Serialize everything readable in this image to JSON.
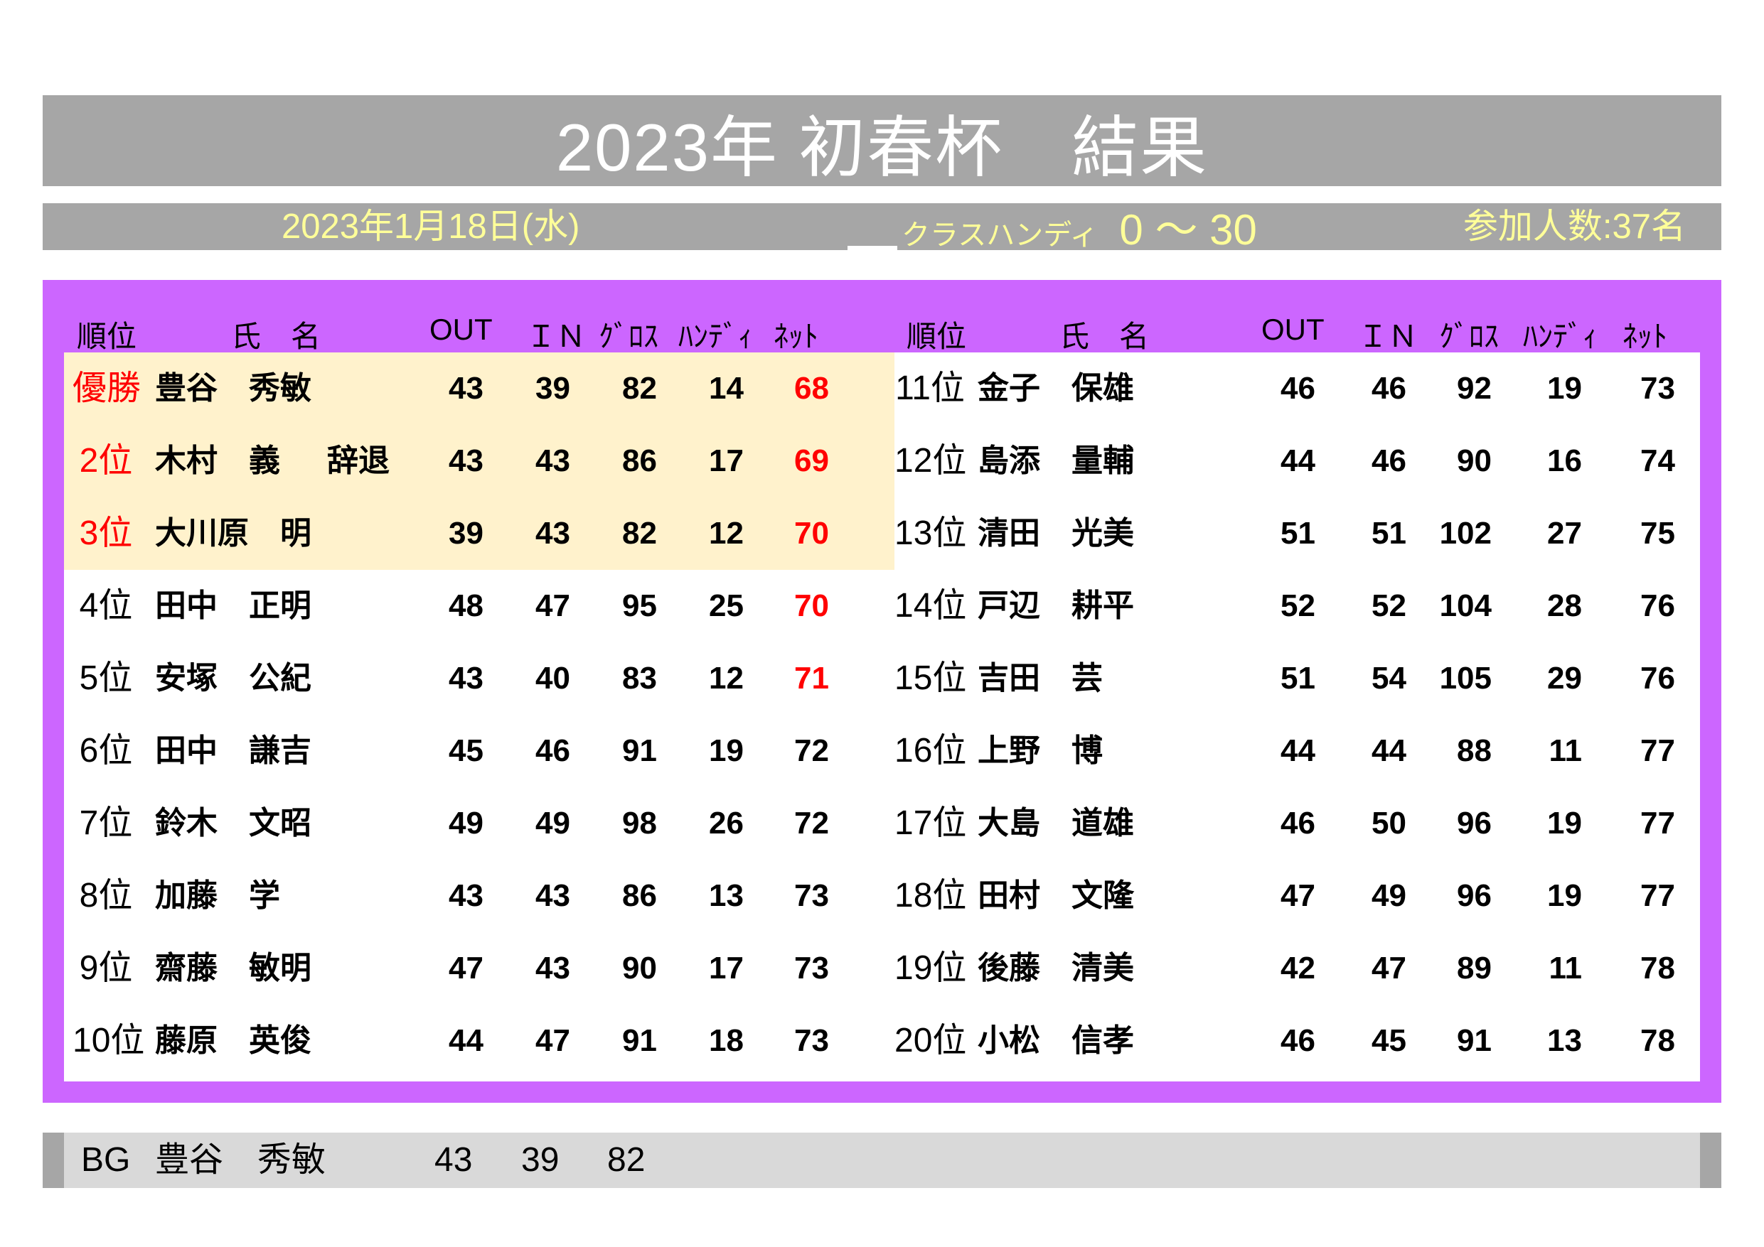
{
  "title": "2023年 初春杯　結果",
  "subtitle": {
    "date": "2023年1月18日(水)",
    "class_label": "クラスハンディ",
    "class_value": "0 ～ 30",
    "participants": "参加人数:37名"
  },
  "headers": {
    "rank": "順位",
    "name": "氏　名",
    "out": "OUT",
    "in": "ＩＮ",
    "gross": "ｸﾞﾛｽ",
    "handicap": "ﾊﾝﾃﾞｨ",
    "net": "ﾈｯﾄ"
  },
  "left_rows": [
    {
      "rank": "優勝",
      "name": "豊谷　秀敏",
      "note": "",
      "out": "43",
      "in": "39",
      "gross": "82",
      "hdcp": "14",
      "net": "68"
    },
    {
      "rank": "2位",
      "name": "木村　義",
      "note": "辞退",
      "out": "43",
      "in": "43",
      "gross": "86",
      "hdcp": "17",
      "net": "69"
    },
    {
      "rank": "3位",
      "name": "大川原　明",
      "note": "",
      "out": "39",
      "in": "43",
      "gross": "82",
      "hdcp": "12",
      "net": "70"
    },
    {
      "rank": "4位",
      "name": "田中　正明",
      "note": "",
      "out": "48",
      "in": "47",
      "gross": "95",
      "hdcp": "25",
      "net": "70"
    },
    {
      "rank": "5位",
      "name": "安塚　公紀",
      "note": "",
      "out": "43",
      "in": "40",
      "gross": "83",
      "hdcp": "12",
      "net": "71"
    },
    {
      "rank": "6位",
      "name": "田中　謙吉",
      "note": "",
      "out": "45",
      "in": "46",
      "gross": "91",
      "hdcp": "19",
      "net": "72"
    },
    {
      "rank": "7位",
      "name": "鈴木　文昭",
      "note": "",
      "out": "49",
      "in": "49",
      "gross": "98",
      "hdcp": "26",
      "net": "72"
    },
    {
      "rank": "8位",
      "name": "加藤　学",
      "note": "",
      "out": "43",
      "in": "43",
      "gross": "86",
      "hdcp": "13",
      "net": "73"
    },
    {
      "rank": "9位",
      "name": "齋藤　敏明",
      "note": "",
      "out": "47",
      "in": "43",
      "gross": "90",
      "hdcp": "17",
      "net": "73"
    },
    {
      "rank": "10位",
      "name": "藤原　英俊",
      "note": "",
      "out": "44",
      "in": "47",
      "gross": "91",
      "hdcp": "18",
      "net": "73"
    }
  ],
  "right_rows": [
    {
      "rank": "11位",
      "name": "金子　保雄",
      "out": "46",
      "in": "46",
      "gross": "92",
      "hdcp": "19",
      "net": "73"
    },
    {
      "rank": "12位",
      "name": "島添　量輔",
      "out": "44",
      "in": "46",
      "gross": "90",
      "hdcp": "16",
      "net": "74"
    },
    {
      "rank": "13位",
      "name": "清田　光美",
      "out": "51",
      "in": "51",
      "gross": "102",
      "hdcp": "27",
      "net": "75"
    },
    {
      "rank": "14位",
      "name": "戸辺　耕平",
      "out": "52",
      "in": "52",
      "gross": "104",
      "hdcp": "28",
      "net": "76"
    },
    {
      "rank": "15位",
      "name": "吉田　芸",
      "out": "51",
      "in": "54",
      "gross": "105",
      "hdcp": "29",
      "net": "76"
    },
    {
      "rank": "16位",
      "name": "上野　博",
      "out": "44",
      "in": "44",
      "gross": "88",
      "hdcp": "11",
      "net": "77"
    },
    {
      "rank": "17位",
      "name": "大島　道雄",
      "out": "46",
      "in": "50",
      "gross": "96",
      "hdcp": "19",
      "net": "77"
    },
    {
      "rank": "18位",
      "name": "田村　文隆",
      "out": "47",
      "in": "49",
      "gross": "96",
      "hdcp": "19",
      "net": "77"
    },
    {
      "rank": "19位",
      "name": "後藤　清美",
      "out": "42",
      "in": "47",
      "gross": "89",
      "hdcp": "11",
      "net": "78"
    },
    {
      "rank": "20位",
      "name": "小松　信孝",
      "out": "46",
      "in": "45",
      "gross": "91",
      "hdcp": "13",
      "net": "78"
    }
  ],
  "best_gross": {
    "label": "BG",
    "name": "豊谷　秀敏",
    "out": "43",
    "in": "39",
    "gross": "82"
  },
  "colors": {
    "title_bar": "#a6a6a6",
    "subtitle_text": "#ffff99",
    "frame": "#cc66ff",
    "podium_fill": "#fff2cc",
    "highlight": "#ff0000",
    "bottom_bar": "#d9d9d9"
  }
}
